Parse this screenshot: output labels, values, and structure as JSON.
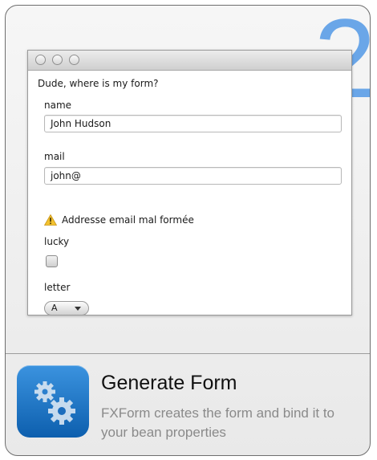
{
  "step": {
    "number": "2",
    "color": "#6aa6e8"
  },
  "window": {
    "form_title": "Dude, where is my form?",
    "fields": {
      "name": {
        "label": "name",
        "value": "John Hudson"
      },
      "mail": {
        "label": "mail",
        "value": "john@"
      },
      "lucky": {
        "label": "lucky",
        "checked": false
      },
      "letter": {
        "label": "letter",
        "selected": "A"
      }
    },
    "warning": {
      "icon": "warning-icon",
      "text": "Addresse email mal formée"
    }
  },
  "feature": {
    "icon": "gears-icon",
    "title": "Generate Form",
    "description": "FXForm creates the form and bind it to your bean properties"
  }
}
